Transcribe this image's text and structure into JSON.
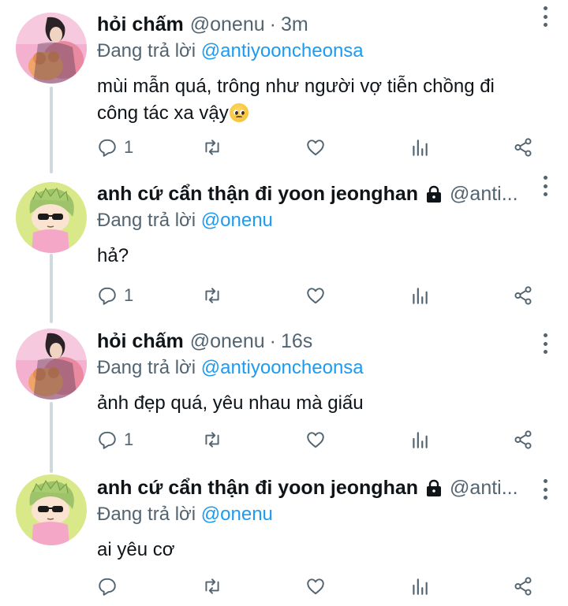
{
  "tweets": [
    {
      "avatar": "photo-avatar-pink",
      "name": "hỏi chấm",
      "handle": "@onenu",
      "separator": "·",
      "time": "3m",
      "locked": false,
      "reply_prefix": "Đang trả lời ",
      "reply_mention": "@antiyooncheonsa",
      "text_lines": [
        "mùi mẫn quá, trông như người vợ tiễn chồng đi",
        "công tác xa vậy"
      ],
      "emoji": "pleading-face",
      "reply_count": "1"
    },
    {
      "avatar": "cartoon-avatar-green",
      "name": "anh cứ cẩn thận đi yoon jeonghan",
      "handle": "@anti...",
      "locked": true,
      "reply_prefix": "Đang trả lời ",
      "reply_mention": "@onenu",
      "text_lines": [
        "hả?"
      ],
      "reply_count": "1"
    },
    {
      "avatar": "photo-avatar-pink",
      "name": "hỏi chấm",
      "handle": "@onenu",
      "separator": "·",
      "time": "16s",
      "locked": false,
      "reply_prefix": "Đang trả lời ",
      "reply_mention": "@antiyooncheonsa",
      "text_lines": [
        "ảnh đẹp quá, yêu nhau mà giấu"
      ],
      "reply_count": "1"
    },
    {
      "avatar": "cartoon-avatar-green",
      "name": "anh cứ cẩn thận đi yoon jeonghan",
      "handle": "@anti...",
      "locked": true,
      "reply_prefix": "Đang trả lời ",
      "reply_mention": "@onenu",
      "text_lines": [
        "ai yêu cơ"
      ],
      "reply_count": ""
    }
  ],
  "icons": {
    "reply": "reply-icon",
    "retweet": "retweet-icon",
    "like": "heart-icon",
    "stats": "stats-icon",
    "share": "share-icon",
    "more": "more-options-icon",
    "lock": "lock-icon"
  },
  "colors": {
    "text": "#0f1419",
    "secondary": "#536471",
    "link": "#1d9bf0",
    "thread_line": "#cfd9de"
  }
}
